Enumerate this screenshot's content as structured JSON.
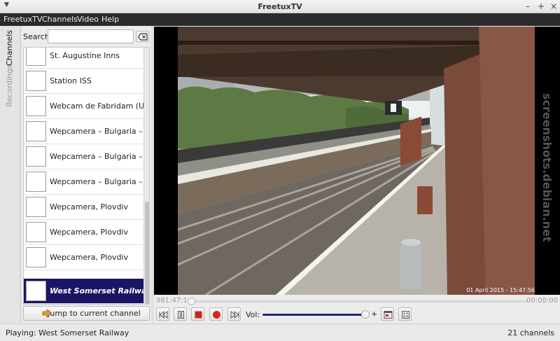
{
  "window": {
    "title": "FreetuxTV"
  },
  "menubar": {
    "items": [
      "FreetuxTV",
      "Channels",
      "Video",
      "Help"
    ]
  },
  "sidebar_tabs": {
    "channels": "Channels",
    "recordings": "Recordings"
  },
  "search": {
    "label": "Search:",
    "value": ""
  },
  "channels": [
    {
      "name": "St. Augustine Inns",
      "selected": false
    },
    {
      "name": "Station ISS",
      "selected": false
    },
    {
      "name": "Webcam de Fabridam (USA)",
      "selected": false
    },
    {
      "name": "Wepcamera – Bulgaria – Kiten",
      "selected": false
    },
    {
      "name": "Wepcamera – Bulgaria – Kiten",
      "selected": false
    },
    {
      "name": "Wepcamera – Bulgaria – Kiten",
      "selected": false
    },
    {
      "name": "Wepcamera, Plovdiv",
      "selected": false
    },
    {
      "name": "Wepcamera, Plovdiv",
      "selected": false
    },
    {
      "name": "Wepcamera, Plovdiv",
      "selected": false
    },
    {
      "name": "West Somerset Railway",
      "selected": true
    }
  ],
  "jump_button": {
    "label": "Jump to current channel"
  },
  "video": {
    "overlay_timestamp": "01 April 2015 - 15:47:56",
    "watermark": "screenshots.debian.net"
  },
  "seek": {
    "elapsed": "981:47:14",
    "remaining": "00:00:00",
    "progress": 0.0
  },
  "controls": {
    "volume_label": "Vol: -",
    "volume_plus": "+",
    "volume_level": 0.98
  },
  "statusbar": {
    "playing": "Playing: West Somerset Railway",
    "count": "21 channels"
  },
  "colors": {
    "selection": "#1b1565",
    "accent": "#1f2a7e",
    "record": "#d9261c",
    "stop": "#c8271d"
  }
}
